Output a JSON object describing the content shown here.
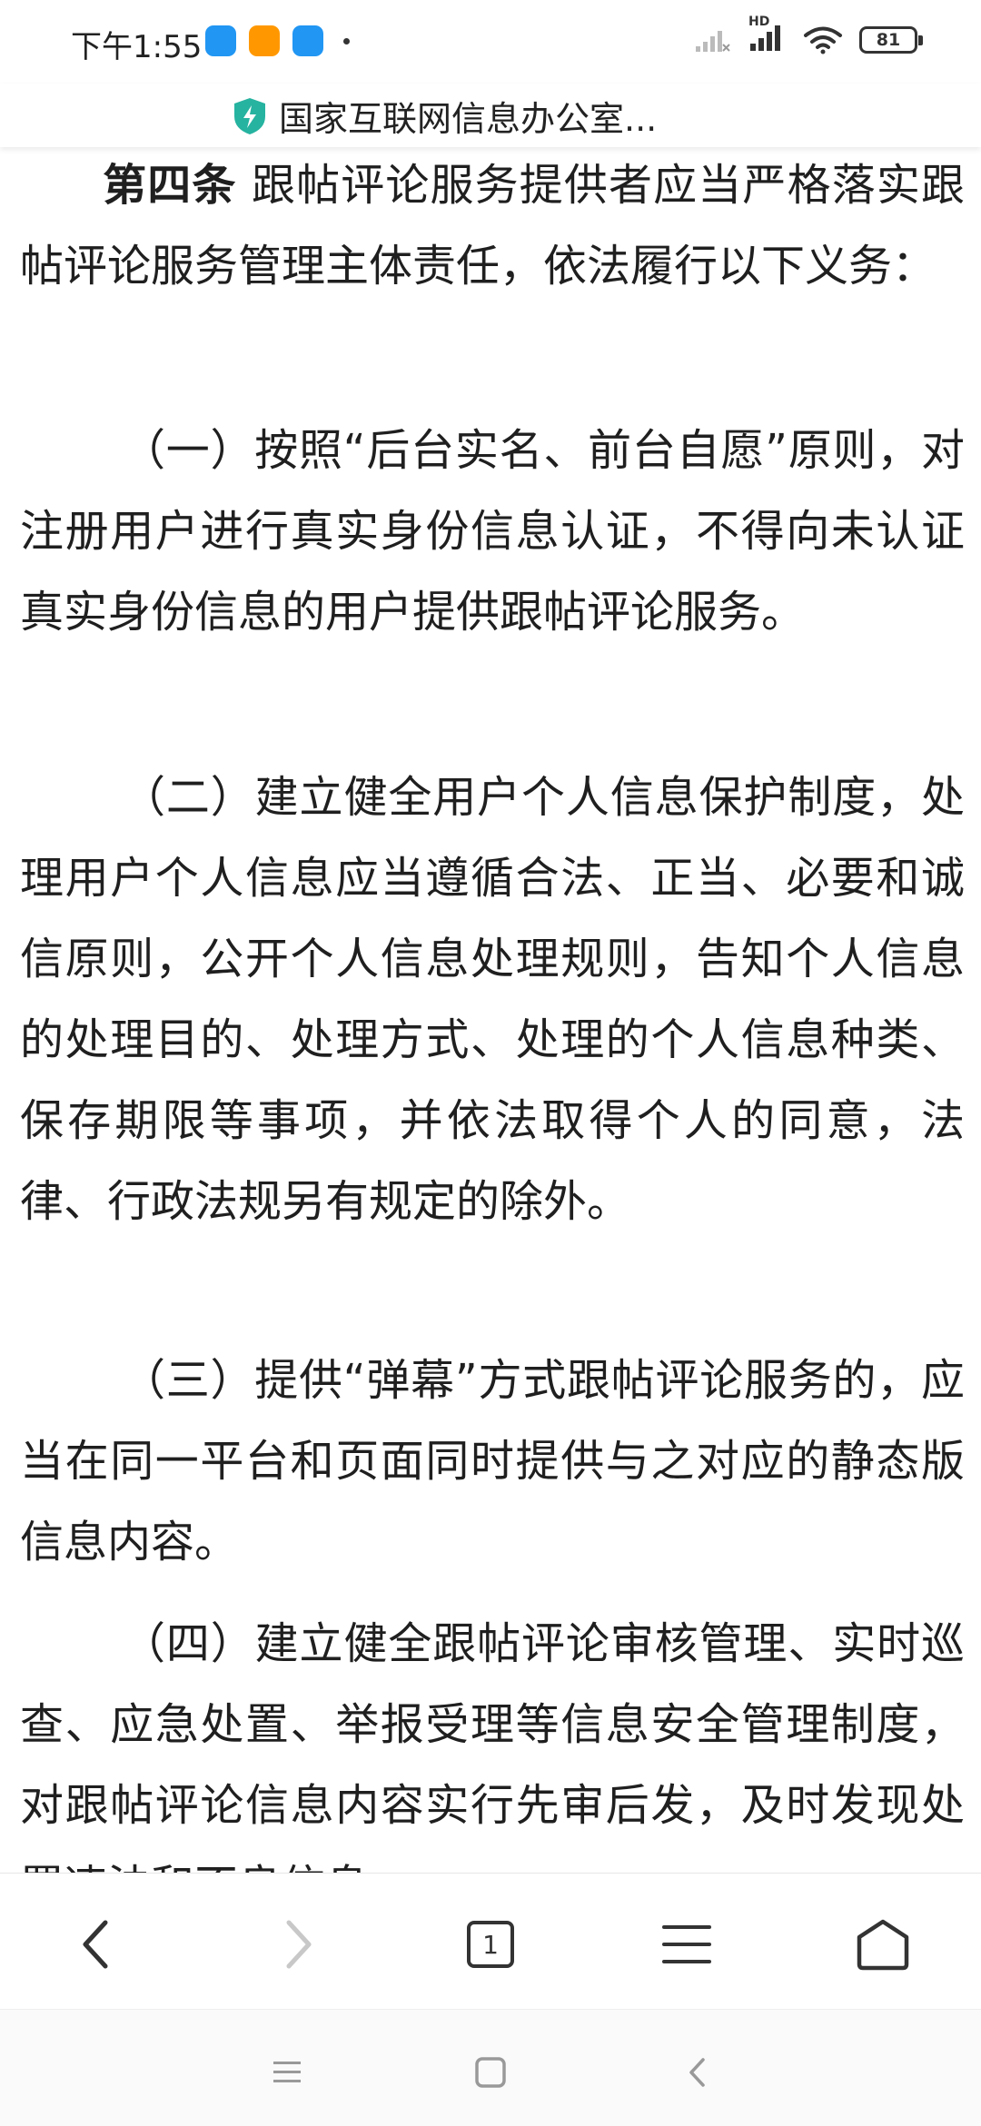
{
  "status_bar": {
    "time": "下午1:55",
    "network_label": "HD",
    "battery": "81",
    "notification_colors": [
      "#2196f3",
      "#ff9800",
      "#2196f3"
    ]
  },
  "url_bar": {
    "site_title": "国家互联网信息办公室..."
  },
  "article": {
    "article4_heading": "第四条",
    "article4_text": " 跟帖评论服务提供者应当严格落实跟帖评论服务管理主体责任，依法履行以下义务：",
    "item1": "（一）按照“后台实名、前台自愿”原则，对注册用户进行真实身份信息认证，不得向未认证真实身份信息的用户提供跟帖评论服务。",
    "item2": "（二）建立健全用户个人信息保护制度，处理用户个人信息应当遵循合法、正当、必要和诚信原则，公开个人信息处理规则，告知个人信息的处理目的、处理方式、处理的个人信息种类、保存期限等事项，并依法取得个人的同意，法律、行政法规另有规定的除外。",
    "item3": "（三）提供“弹幕”方式跟帖评论服务的，应当在同一平台和页面同时提供与之对应的静态版信息内容。",
    "item4": "（四）建立健全跟帖评论审核管理、实时巡查、应急处置、举报受理等信息安全管理制度，对跟帖评论信息内容实行先审后发，及时发现处置违法和不良信息"
  },
  "toolbar": {
    "tab_count": "1"
  }
}
